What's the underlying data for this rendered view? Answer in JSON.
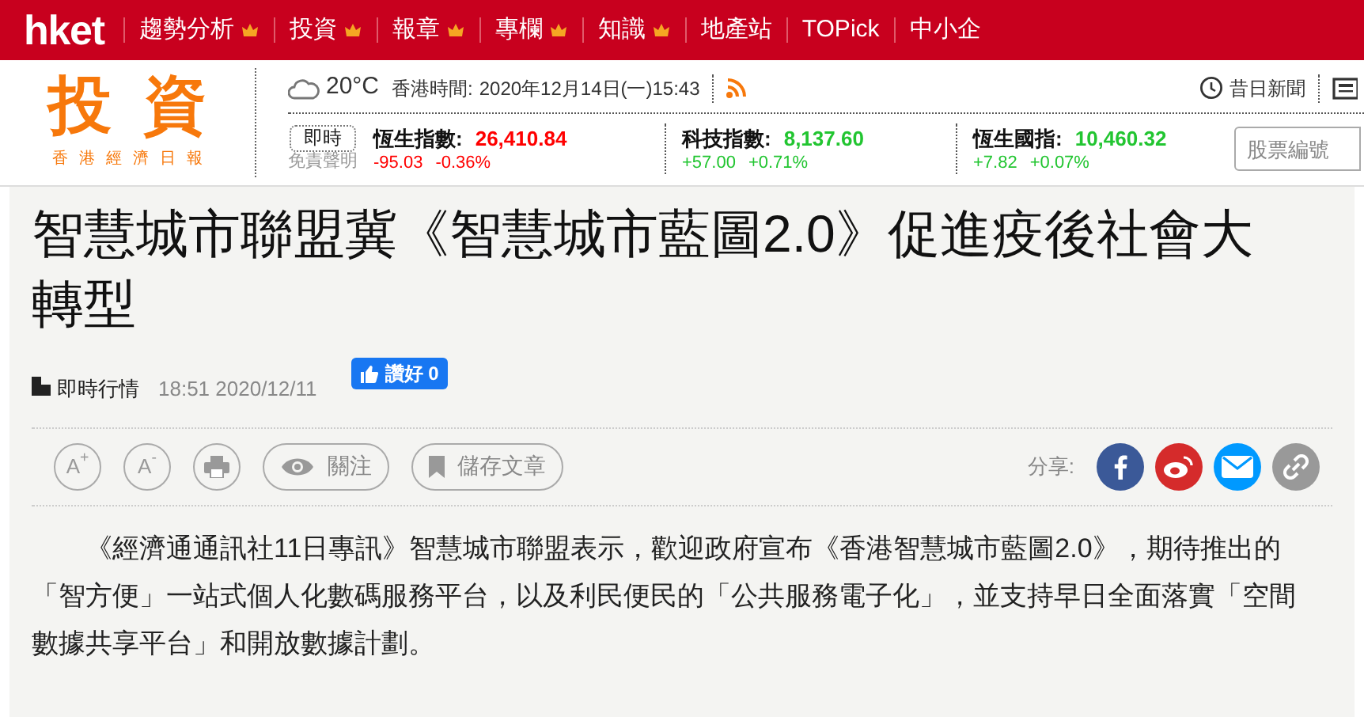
{
  "top_nav": {
    "logo": "hket",
    "items": [
      {
        "label": "趨勢分析",
        "premium": true
      },
      {
        "label": "投資",
        "premium": true
      },
      {
        "label": "報章",
        "premium": true
      },
      {
        "label": "專欄",
        "premium": true
      },
      {
        "label": "知識",
        "premium": true
      },
      {
        "label": "地產站",
        "premium": false
      },
      {
        "label": "TOPick",
        "premium": false
      },
      {
        "label": "中小企",
        "premium": false
      }
    ]
  },
  "header": {
    "brand": "投資",
    "brand_sub": "香港經濟日報",
    "temperature": "20°C",
    "time_label": "香港時間:",
    "time": "2020年12月14日(一)15:43",
    "archive_link": "昔日新聞",
    "realtime_button": "即時",
    "disclaimer": "免責聲明",
    "indices": [
      {
        "name": "恆生指數:",
        "value": "26,410.84",
        "change": "-95.03",
        "pct": "-0.36%",
        "kind": "down"
      },
      {
        "name": "科技指數:",
        "value": "8,137.60",
        "change": "+57.00",
        "pct": "+0.71%",
        "kind": "up"
      },
      {
        "name": "恆生國指:",
        "value": "10,460.32",
        "change": "+7.82",
        "pct": "+0.07%",
        "kind": "up"
      }
    ],
    "search": {
      "placeholder": "股票編號"
    }
  },
  "article": {
    "title": "智慧城市聯盟冀《智慧城市藍圖2.0》促進疫後社會大轉型",
    "category": "即時行情",
    "datetime": "18:51 2020/12/11",
    "like_button": "讚好 0",
    "tools": [
      {
        "kind": "text-size",
        "label": "A$^{+}$"
      },
      {
        "kind": "text-size",
        "label": "A$^{-}$"
      },
      {
        "kind": "print"
      },
      {
        "kind": "follow",
        "label": "關注"
      },
      {
        "kind": "save",
        "label": "儲存文章"
      }
    ],
    "share_label": "分享:",
    "share": [
      {
        "kind": "facebook",
        "color": "#3b5998"
      },
      {
        "kind": "weibo",
        "color": "#d52b2b"
      },
      {
        "kind": "email",
        "color": "#0099ff"
      },
      {
        "kind": "link",
        "color": "#999999"
      }
    ],
    "body": "《經濟通通訊社11日專訊》智慧城市聯盟表示，歡迎政府宣布《香港智慧城市藍圖2.0》，期待推出的「智方便」一站式個人化數碼服務平台，以及利民便民的「公共服務電子化」，並支持早日全面落實「空間數據共享平台」和開放數據計劃。"
  }
}
